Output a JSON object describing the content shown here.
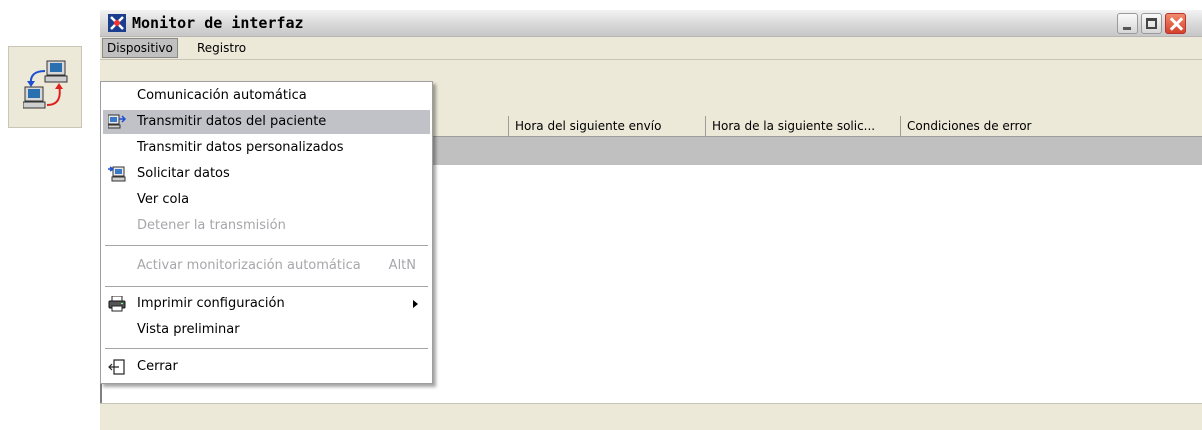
{
  "window": {
    "title": "Monitor de interfaz"
  },
  "menubar": {
    "items": [
      "Dispositivo",
      "Registro"
    ]
  },
  "list": {
    "columns": [
      "",
      "Hora del siguiente envío",
      "Hora de la siguiente solic...",
      "Condiciones de error"
    ]
  },
  "dropdown": {
    "items": [
      {
        "label": "Comunicación automática",
        "enabled": true
      },
      {
        "label": "Transmitir datos del paciente",
        "enabled": true,
        "highlighted": true,
        "icon": "transmit-icon"
      },
      {
        "label": "Transmitir datos personalizados",
        "enabled": true
      },
      {
        "label": "Solicitar datos",
        "enabled": true,
        "icon": "request-data-icon"
      },
      {
        "label": "Ver cola",
        "enabled": true
      },
      {
        "label": "Detener la transmisión",
        "enabled": false
      },
      {
        "label": "Activar monitorización automática",
        "enabled": false,
        "shortcut": "AltN"
      },
      {
        "label": "Imprimir configuración",
        "enabled": true,
        "icon": "printer-icon",
        "submenu": true
      },
      {
        "label": "Vista preliminar",
        "enabled": true
      },
      {
        "label": "Cerrar",
        "enabled": true,
        "icon": "exit-icon"
      }
    ]
  },
  "colors": {
    "highlight": "#c1c1c8",
    "disabled_text": "#a7a6aa",
    "chrome": "#ece9d8"
  }
}
